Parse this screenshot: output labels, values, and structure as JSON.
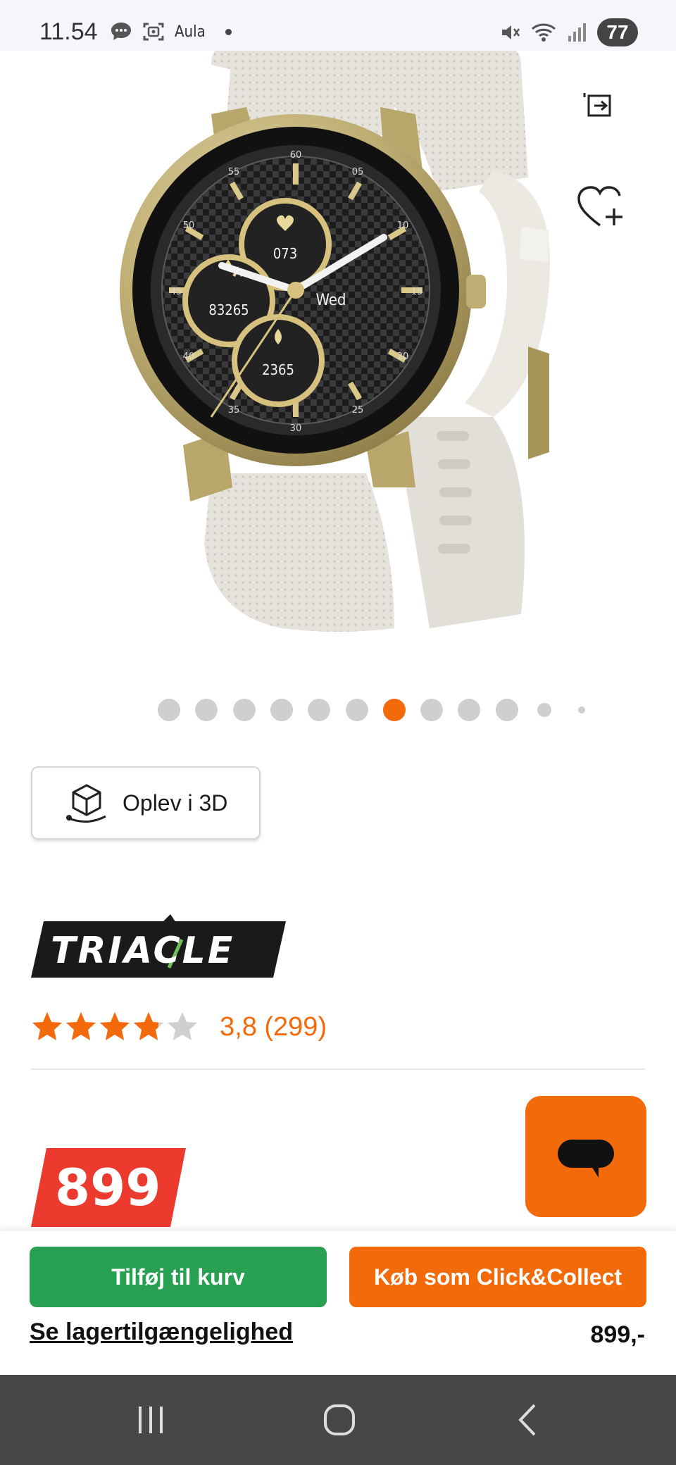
{
  "status_bar": {
    "time": "11.54",
    "app_label": "Aula",
    "battery": "77"
  },
  "product": {
    "image_alt": "Smartwatch with gold case and light grey strap",
    "watch_face": {
      "steps": "83265",
      "heart_rate": "073",
      "calories": "2365",
      "weekday": "Wed"
    }
  },
  "carousel": {
    "count": 12,
    "active_index": 6
  },
  "experience_3d": {
    "label": "Oplev i 3D"
  },
  "brand": {
    "name": "TRIACLE"
  },
  "rating": {
    "value": 3.8,
    "max": 5,
    "text": "3,8 (299)"
  },
  "price_badge": {
    "text": "899"
  },
  "bottom_bar": {
    "add_to_cart": "Tilføj til kurv",
    "click_collect": "Køb som Click&Collect",
    "stock_link": "Se lagertilgængelighed",
    "price": "899,-"
  },
  "colors": {
    "accent_orange": "#f26a0a",
    "cart_green": "#27a052",
    "price_red": "#ec3a2e",
    "nav_bar": "#474747"
  },
  "icons": {
    "share": "share-icon",
    "wishlist": "heart-plus-icon",
    "chat": "chat-bubble-icon",
    "three_d": "cube-3d-icon"
  }
}
